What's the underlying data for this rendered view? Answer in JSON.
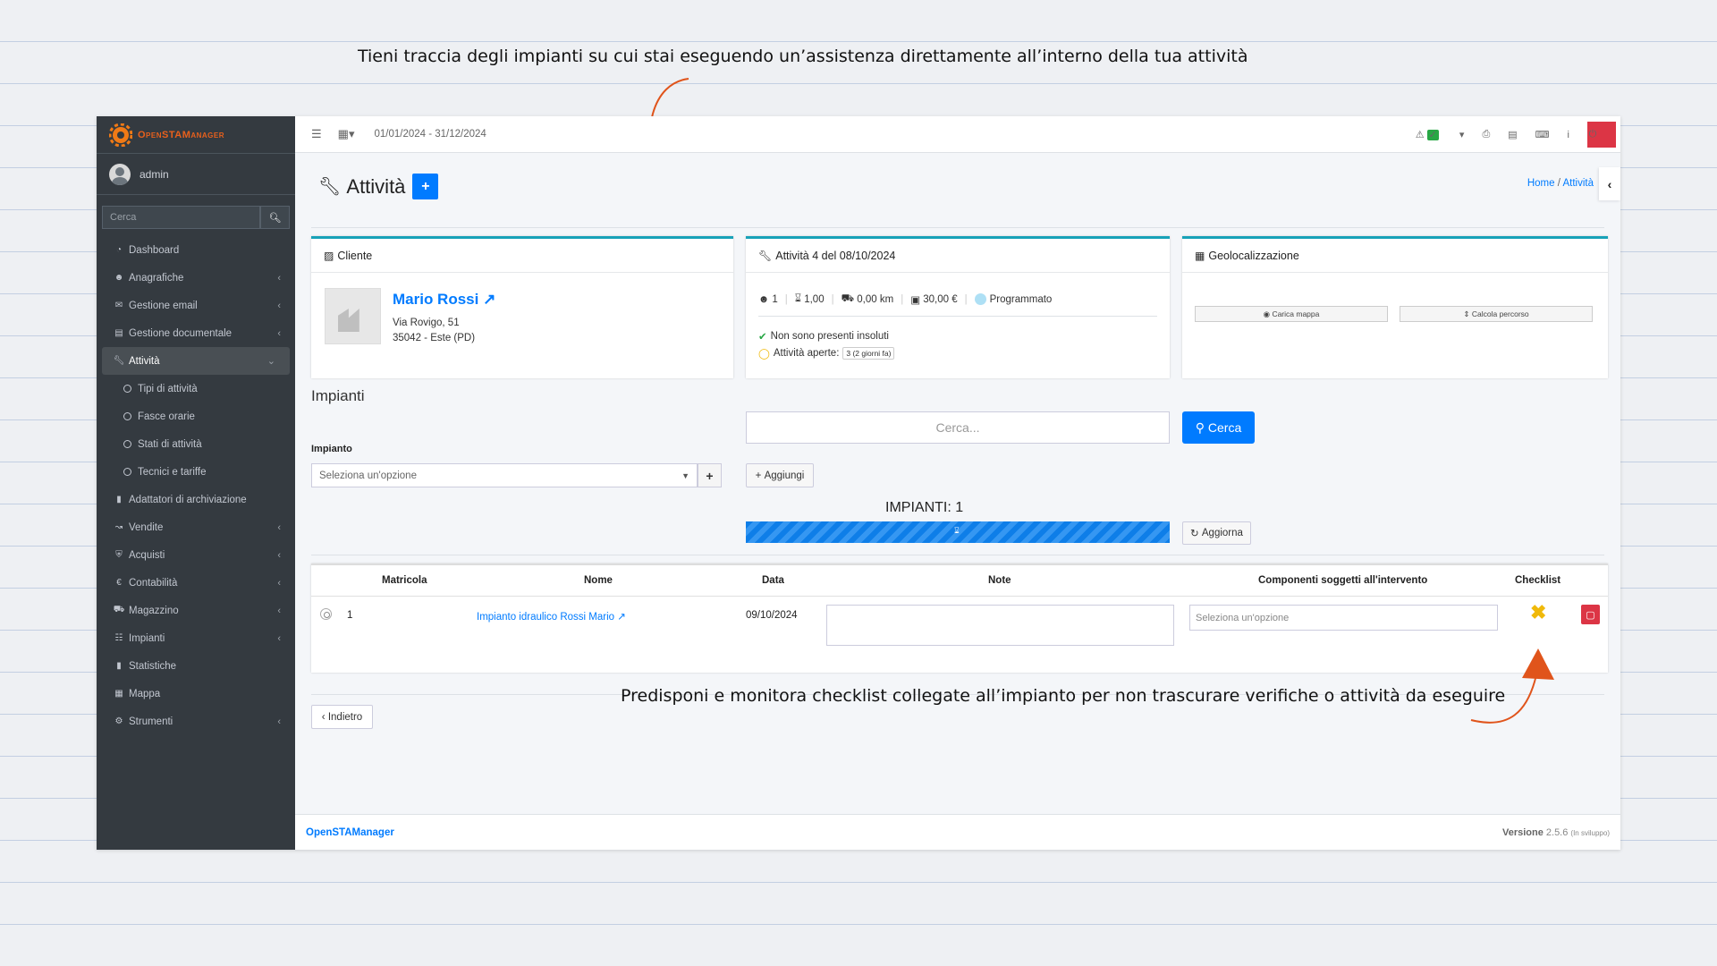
{
  "captions": {
    "top": "Tieni traccia degli impianti su cui stai eseguendo un’assistenza direttamente all’interno della tua attività",
    "bottom": "Predisponi e monitora checklist collegate all’impianto per non trascurare verifiche o attività da eseguire"
  },
  "colors": {
    "accent": "#007bff",
    "arrow": "#e0541b",
    "sidebar": "#343a40",
    "danger": "#dc3545",
    "warning": "#f0b90a",
    "card_border": "#17a2b8"
  },
  "brand": {
    "name": "OpenSTAManager"
  },
  "user": {
    "name": "admin"
  },
  "sidebar": {
    "search_placeholder": "Cerca",
    "items": [
      {
        "label": "Dashboard",
        "icon": "dashboard-icon",
        "has_children": false
      },
      {
        "label": "Anagrafiche",
        "icon": "users-icon",
        "has_children": true
      },
      {
        "label": "Gestione email",
        "icon": "envelope-icon",
        "has_children": true
      },
      {
        "label": "Gestione documentale",
        "icon": "document-icon",
        "has_children": true
      },
      {
        "label": "Attività",
        "icon": "wrench-icon",
        "has_children": true,
        "active": true
      },
      {
        "label": "Tipi di attività",
        "sub": true
      },
      {
        "label": "Fasce orarie",
        "sub": true
      },
      {
        "label": "Stati di attività",
        "sub": true
      },
      {
        "label": "Tecnici e tariffe",
        "sub": true
      },
      {
        "label": "Adattatori di archiviazione",
        "icon": "folder-icon",
        "has_children": false
      },
      {
        "label": "Vendite",
        "icon": "chart-icon",
        "has_children": true
      },
      {
        "label": "Acquisti",
        "icon": "cart-icon",
        "has_children": true
      },
      {
        "label": "Contabilità",
        "icon": "euro-icon",
        "has_children": true
      },
      {
        "label": "Magazzino",
        "icon": "truck-icon",
        "has_children": true
      },
      {
        "label": "Impianti",
        "icon": "sitemap-icon",
        "has_children": true
      },
      {
        "label": "Statistiche",
        "icon": "bar-chart-icon",
        "has_children": false
      },
      {
        "label": "Mappa",
        "icon": "map-icon",
        "has_children": false
      },
      {
        "label": "Strumenti",
        "icon": "cog-icon",
        "has_children": true
      }
    ]
  },
  "topbar": {
    "date_range": "01/01/2024 - 31/12/2024"
  },
  "page": {
    "title": "Attività"
  },
  "breadcrumb": {
    "home": "Home",
    "current": "Attività",
    "sep": "/"
  },
  "cliente": {
    "header": "Cliente",
    "name": "Mario Rossi",
    "address1": "Via Rovigo, 51",
    "address2": "35042 - Este (PD)"
  },
  "attivita": {
    "header": "Attività 4 del 08/10/2024",
    "stats": {
      "people": "1",
      "hours": "1,00",
      "km": "0,00 km",
      "amount": "30,00 €",
      "status": "Programmato"
    },
    "insoluti": "Non sono presenti insoluti",
    "aperte_label": "Attività aperte:",
    "aperte_value": "3 (2 giorni fa)"
  },
  "geo": {
    "header": "Geolocalizzazione",
    "load_map": "Carica mappa",
    "calc_route": "Calcola percorso"
  },
  "impianti": {
    "section_title": "Impianti",
    "search_placeholder": "Cerca...",
    "search_button": "Cerca",
    "field_label": "Impianto",
    "select_placeholder": "Seleziona un'opzione",
    "add_button": "Aggiungi",
    "count_label": "IMPIANTI: 1",
    "progress_percent": 100,
    "refresh_button": "Aggiorna",
    "table": {
      "headers": {
        "matricola": "Matricola",
        "nome": "Nome",
        "data": "Data",
        "note": "Note",
        "componenti": "Componenti soggetti all'intervento",
        "checklist": "Checklist"
      },
      "rows": [
        {
          "matricola": "1",
          "nome": "Impianto idraulico Rossi Mario",
          "data": "09/10/2024",
          "note": "",
          "componenti_placeholder": "Seleziona un'opzione",
          "checklist_status": "incomplete"
        }
      ]
    }
  },
  "back_button": "Indietro",
  "footer": {
    "brand": "OpenSTAManager",
    "version_label": "Versione",
    "version": "2.5.6",
    "version_note": "(In sviluppo)"
  }
}
